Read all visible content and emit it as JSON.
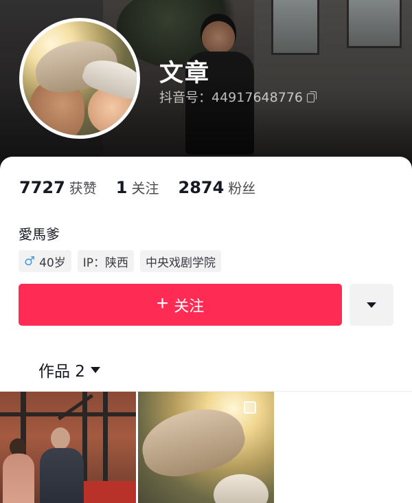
{
  "profile": {
    "name": "文章",
    "douyin_id": "抖音号：44917648776",
    "bio": "愛馬爹"
  },
  "stats": [
    {
      "value": "7727",
      "label": "获赞"
    },
    {
      "value": "1",
      "label": "关注"
    },
    {
      "value": "2874",
      "label": "粉丝"
    }
  ],
  "tags": {
    "gender_symbol": "♂",
    "age": "40岁",
    "ip": "IP：陕西",
    "school": "中央戏剧学院"
  },
  "actions": {
    "follow_plus": "+",
    "follow_label": "关注"
  },
  "works": {
    "tab_label": "作品 2"
  },
  "colors": {
    "follow_button": "#fe2c55",
    "male_icon": "#3a9ee8"
  }
}
